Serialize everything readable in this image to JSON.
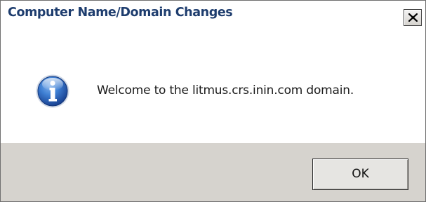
{
  "dialog": {
    "title": "Computer Name/Domain Changes",
    "message": "Welcome to the litmus.crs.inin.com domain.",
    "ok_label": "OK",
    "icon": "info-icon",
    "close_icon": "close-icon"
  },
  "colors": {
    "title_text": "#1e3d6e",
    "footer_background": "#d6d3ce",
    "icon_blue": "#2a62b5"
  }
}
